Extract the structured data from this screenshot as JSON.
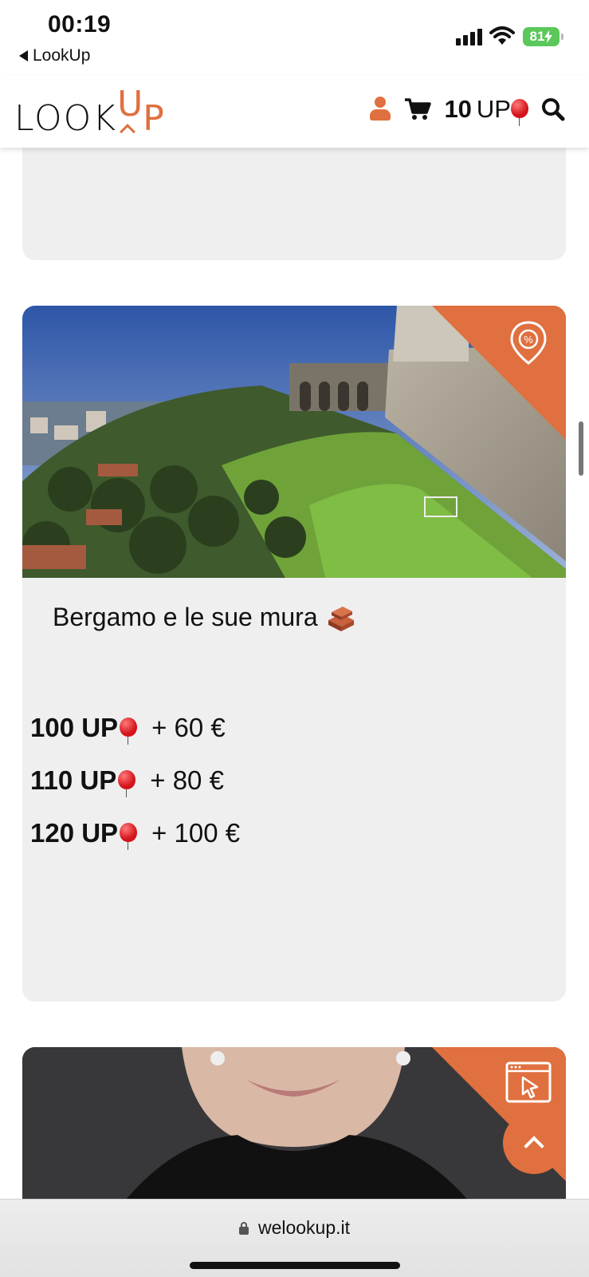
{
  "status_bar": {
    "time": "00:19",
    "back_app": "LookUp",
    "battery": "81"
  },
  "header": {
    "logo_main": "LOOK",
    "logo_up": "UP",
    "up_count": "10",
    "up_unit": "UP"
  },
  "card": {
    "title": "Bergamo e le sue mura",
    "prices": [
      {
        "up": "100 UP",
        "plus": "+ 60 €"
      },
      {
        "up": "110 UP",
        "plus": "+ 80 €"
      },
      {
        "up": "120 UP",
        "plus": "+ 100 €"
      }
    ]
  },
  "browser": {
    "url": "welookup.it"
  },
  "colors": {
    "accent": "#e0703f",
    "card_bg": "#efefef",
    "battery": "#5ac85a"
  },
  "icons": [
    "user-icon",
    "cart-icon",
    "balloon-icon",
    "search-icon",
    "discount-pin-icon",
    "browser-cursor-icon",
    "lock-icon",
    "chevron-up-icon"
  ]
}
